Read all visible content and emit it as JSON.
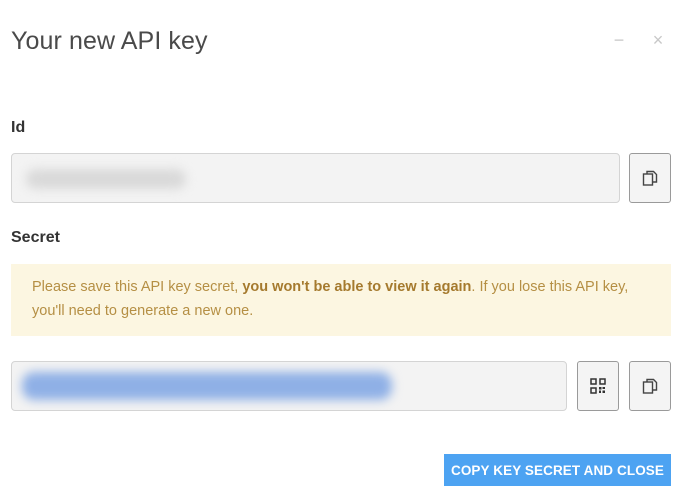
{
  "dialog": {
    "title": "Your new API key",
    "minimize_icon": "−",
    "close_icon": "×"
  },
  "id_field": {
    "label": "Id",
    "value": "",
    "copy_icon": "copy-icon"
  },
  "secret_field": {
    "label": "Secret",
    "warning_prefix": "Please save this API key secret, ",
    "warning_emphasis": "you won't be able to view it again",
    "warning_suffix": ". If you lose this API key, you'll need to generate a new one.",
    "value": "",
    "qr_icon": "qr-code-icon",
    "copy_icon": "copy-icon"
  },
  "footer": {
    "primary_label": "COPY KEY SECRET AND CLOSE"
  },
  "colors": {
    "primary": "#4da3f2",
    "warning_bg": "#fcf6e1",
    "warning_text": "#b58f44"
  }
}
